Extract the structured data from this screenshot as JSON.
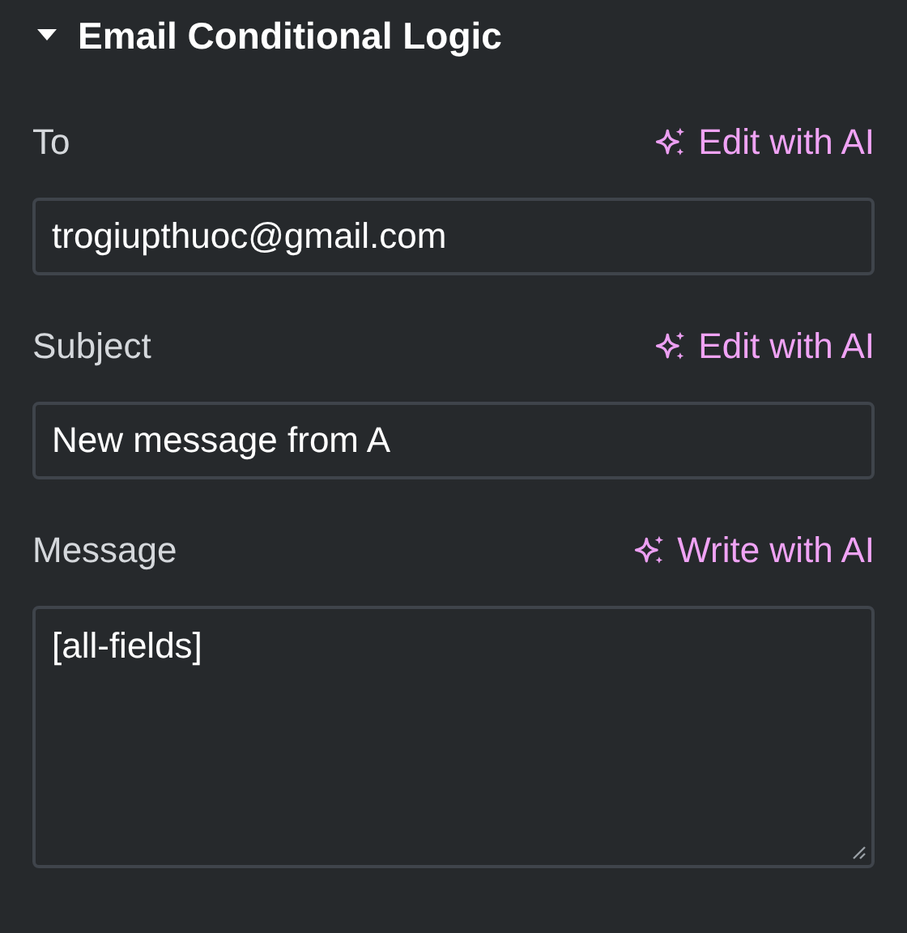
{
  "section": {
    "title": "Email Conditional Logic",
    "expanded": true
  },
  "fields": [
    {
      "kind": "input",
      "label": "To",
      "ai_action": "Edit with AI",
      "value": "trogiupthuoc@gmail.com"
    },
    {
      "kind": "input",
      "label": "Subject",
      "ai_action": "Edit with AI",
      "value": "New message from A"
    },
    {
      "kind": "textarea",
      "label": "Message",
      "ai_action": "Write with AI",
      "value": "[all-fields]"
    }
  ]
}
